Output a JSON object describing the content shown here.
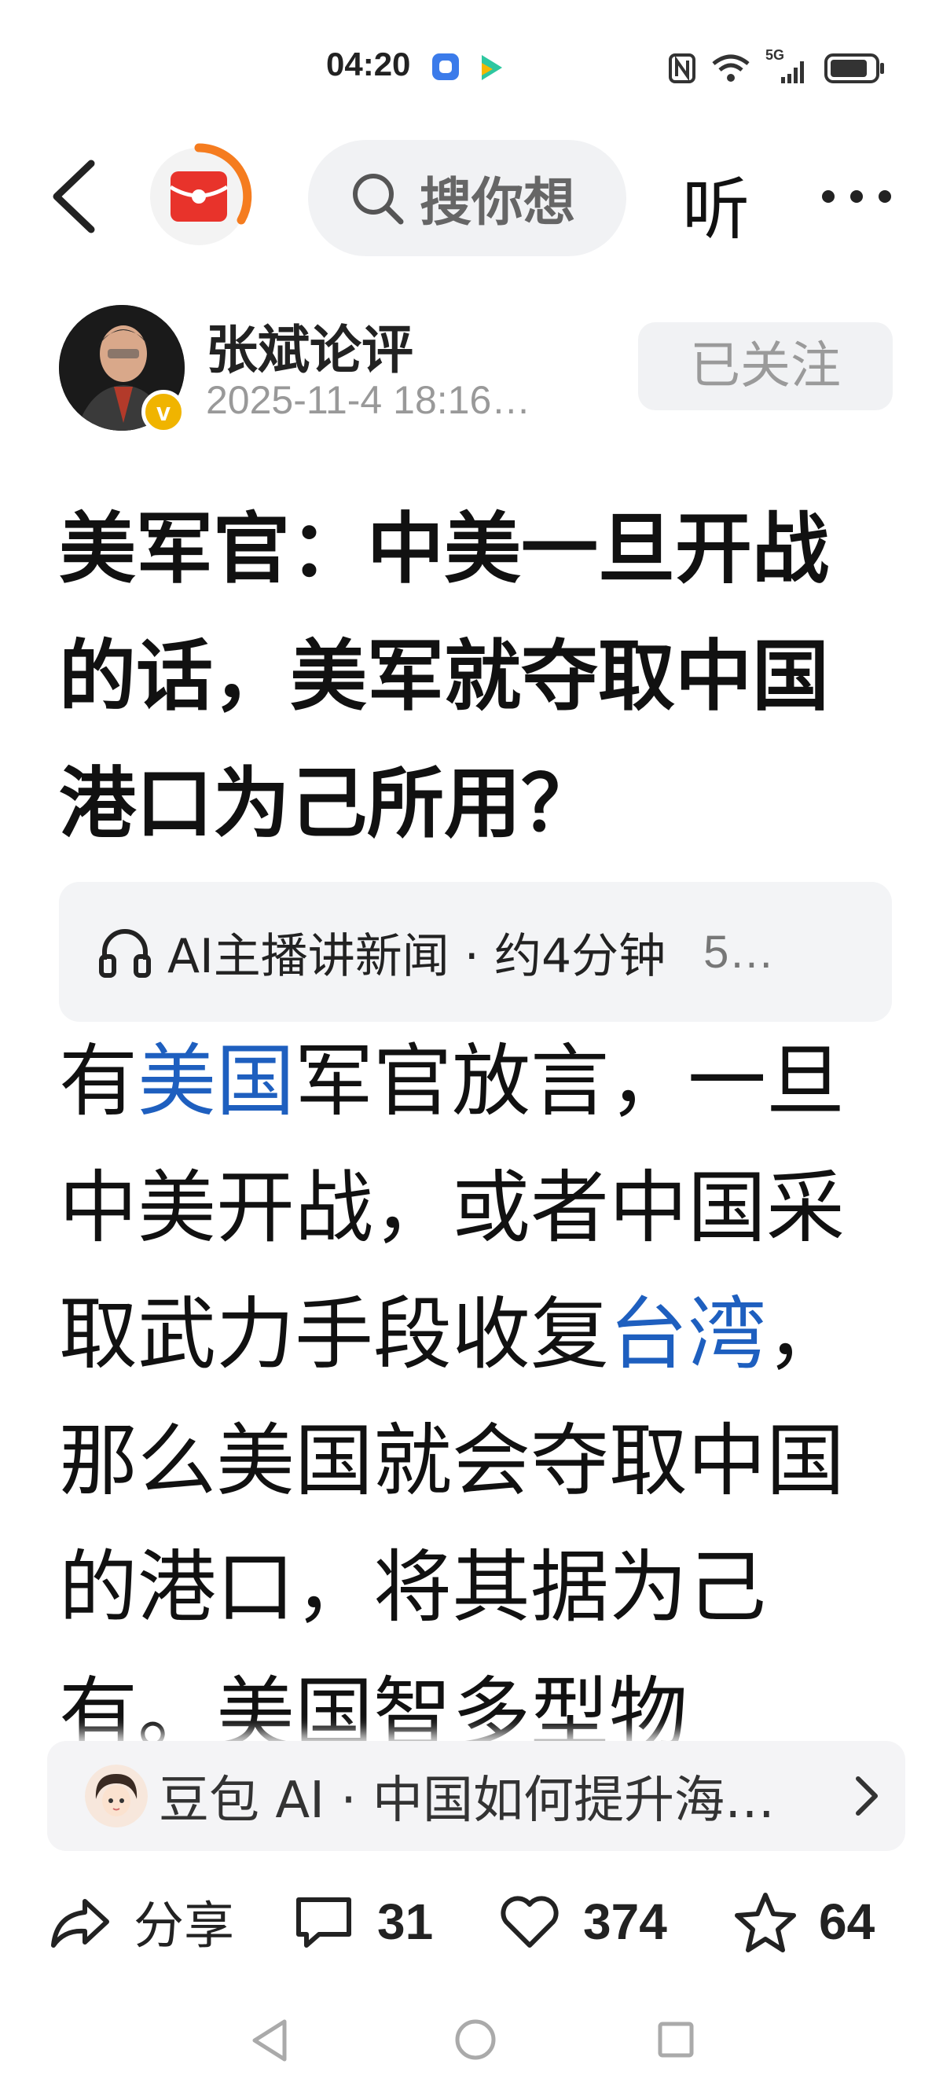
{
  "status_bar": {
    "time": "04:20",
    "network": "5G"
  },
  "top_nav": {
    "search_placeholder": "搜你想",
    "listen_label": "听"
  },
  "author": {
    "name": "张斌论评",
    "time": "2025-11-4 18:16…",
    "follow_label": "已关注",
    "verified_mark": "v"
  },
  "article": {
    "title": "美军官：中美一旦开战的话，美军就夺取中国港口为己所用？",
    "ai_audio_label": "AI主播讲新闻 · 约4分钟",
    "ai_audio_extra": "5…",
    "body": {
      "t1": "有",
      "link1": "美国",
      "t2": "军官放言，一旦中美开战，或者中国采取武力手段收复",
      "link2": "台湾",
      "t3": "，那么美国就会夺取中国的港口，将其据为己有。美国智多型物"
    }
  },
  "doubao": {
    "text": "豆包 AI · 中国如何提升海…"
  },
  "actions": {
    "share_label": "分享",
    "comments": "31",
    "likes": "374",
    "favorites": "64"
  },
  "colors": {
    "link": "#1e5fbf",
    "accent_orange": "#f57c1f",
    "logo_red": "#e8332b"
  }
}
